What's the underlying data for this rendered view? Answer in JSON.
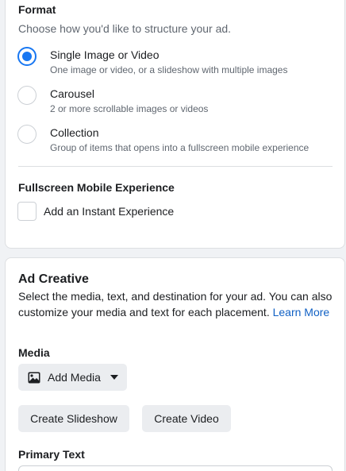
{
  "format": {
    "title": "Format",
    "subtitle": "Choose how you'd like to structure your ad.",
    "options": [
      {
        "label": "Single Image or Video",
        "description": "One image or video, or a slideshow with multiple images",
        "selected": true
      },
      {
        "label": "Carousel",
        "description": "2 or more scrollable images or videos",
        "selected": false
      },
      {
        "label": "Collection",
        "description": "Group of items that opens into a fullscreen mobile experience",
        "selected": false
      }
    ]
  },
  "fullscreen": {
    "title": "Fullscreen Mobile Experience",
    "checkbox_label": "Add an Instant Experience",
    "checked": false
  },
  "ad_creative": {
    "title": "Ad Creative",
    "description": "Select the media, text, and destination for your ad. You can also customize your media and text for each placement.",
    "learn_more": "Learn More",
    "media_label": "Media",
    "add_media_label": "Add Media",
    "create_slideshow_label": "Create Slideshow",
    "create_video_label": "Create Video",
    "primary_text_label": "Primary Text"
  },
  "colors": {
    "accent": "#1877f2",
    "link": "#1060c4",
    "button_bg": "#ebedf0",
    "page_bg": "#f0f2f5"
  }
}
